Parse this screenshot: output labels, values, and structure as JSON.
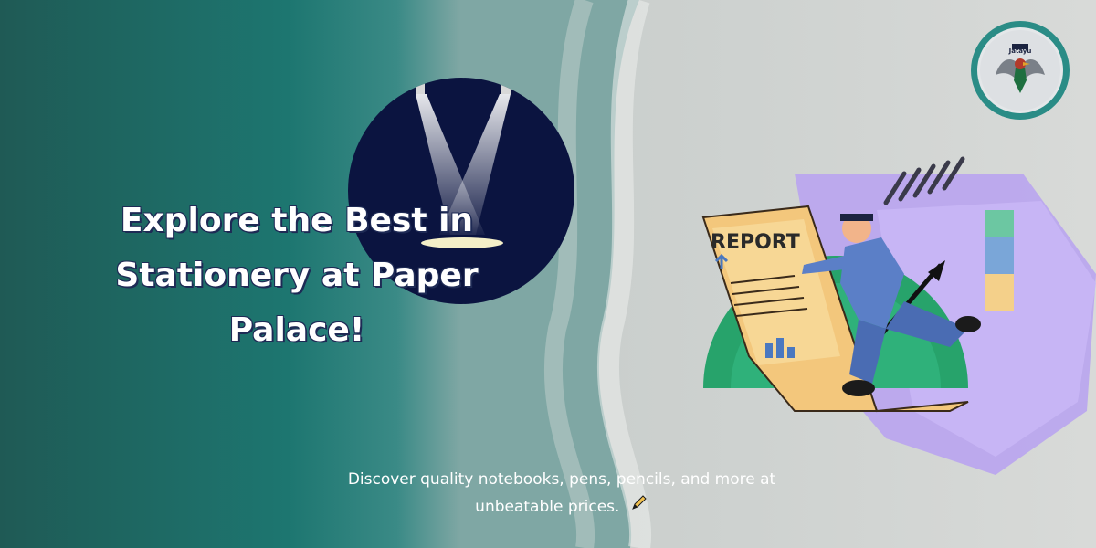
{
  "banner": {
    "headline_lines": [
      "Explore the Best in",
      "Stationery at Paper",
      "Palace!"
    ],
    "tagline_line1": "Discover quality notebooks, pens, pencils, and more at",
    "tagline_line2": "unbeatable prices.",
    "tagline_emoji": "pen-emoji"
  },
  "logo": {
    "name": "Jatayu",
    "icon": "eagle-emblem-icon"
  },
  "illustration": {
    "report_label": "REPORT",
    "icon": "runner-with-report-icon"
  },
  "colors": {
    "sea": "#1f6f6a",
    "sand": "#cdd1d0",
    "spotlight_bg": "#0b1440",
    "text": "#ffffff",
    "notebook": "#b9a4f0",
    "gauge": "#27a36b",
    "report_paper": "#f3c77c"
  }
}
